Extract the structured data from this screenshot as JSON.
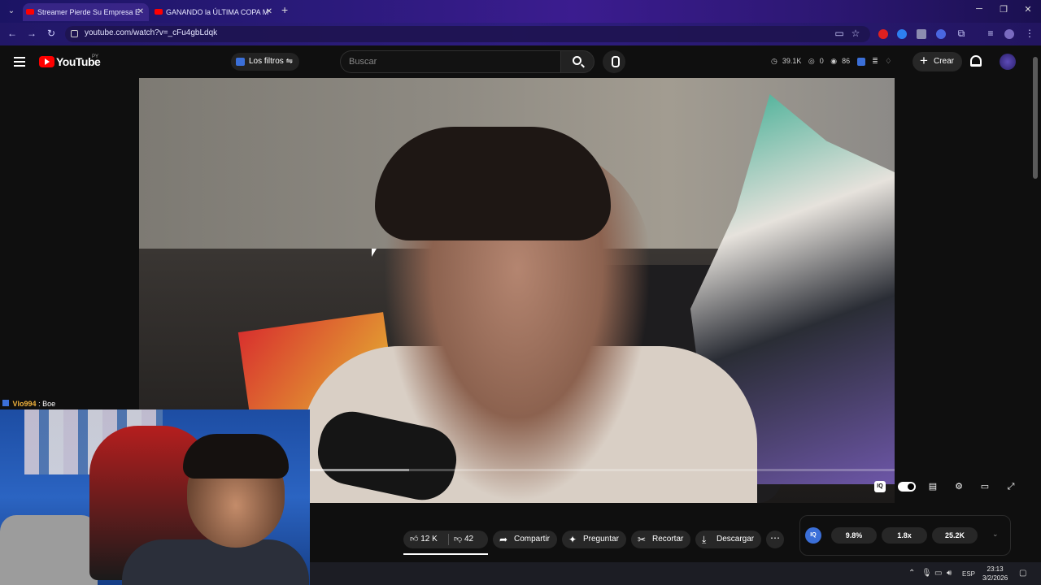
{
  "browser": {
    "tabs": [
      {
        "title": "Streamer Pierde Su Empresa E",
        "active": true
      },
      {
        "title": "GANANDO la ÚLTIMA COPA M",
        "active": false
      }
    ],
    "url": "youtube.com/watch?v=_cFu4gbLdqk"
  },
  "masthead": {
    "logo_text": "YouTube",
    "country_code": "PY",
    "filters_label": "Los filtros",
    "search_placeholder": "Buscar",
    "stats": {
      "views": "39.1K",
      "likes": "0",
      "watchers": "86"
    },
    "create_label": "Crear"
  },
  "chat": {
    "user": "Vlo994",
    "message": ": Boe"
  },
  "actions": {
    "likes": "12 K",
    "dislikes": "42",
    "share": "Compartir",
    "ask": "Preguntar",
    "clip": "Recortar",
    "download": "Descargar"
  },
  "iq_panel": {
    "logo": "IQ",
    "stat1": "9.8%",
    "stat2": "1.8x",
    "stat3": "25.2K"
  },
  "player": {
    "progress_buffered": 0.17,
    "iq_label": "IQ"
  },
  "taskbar": {
    "lang": "ESP",
    "time": "23:13",
    "date": "3/2/2026"
  },
  "icons": [
    "search-icon",
    "mic-icon",
    "bell-icon",
    "like-icon",
    "dislike-icon",
    "share-icon",
    "sparkle-icon",
    "scissors-icon",
    "download-icon",
    "settings-icon",
    "fullscreen-icon",
    "subtitles-icon",
    "theater-icon"
  ]
}
